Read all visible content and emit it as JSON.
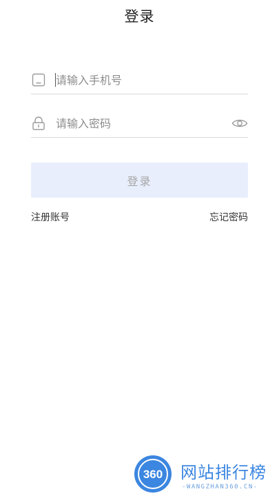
{
  "header": {
    "title": "登录"
  },
  "phone_field": {
    "placeholder": "请输入手机号",
    "value": "",
    "icon": "phone-icon"
  },
  "password_field": {
    "placeholder": "请输入密码",
    "value": "",
    "icon": "lock-icon",
    "toggle_icon": "eye-icon"
  },
  "login_button": {
    "label": "登录"
  },
  "links": {
    "register": "注册账号",
    "forgot_password": "忘记密码"
  },
  "watermark": {
    "logo_text": "360",
    "title": "网站排行榜",
    "subtitle": "-WANGZHAN360.CN-"
  },
  "colors": {
    "button_bg": "#e8eefc",
    "button_text": "#a6a6a6",
    "accent": "#3b86e0",
    "divider": "#d8d8d8"
  }
}
